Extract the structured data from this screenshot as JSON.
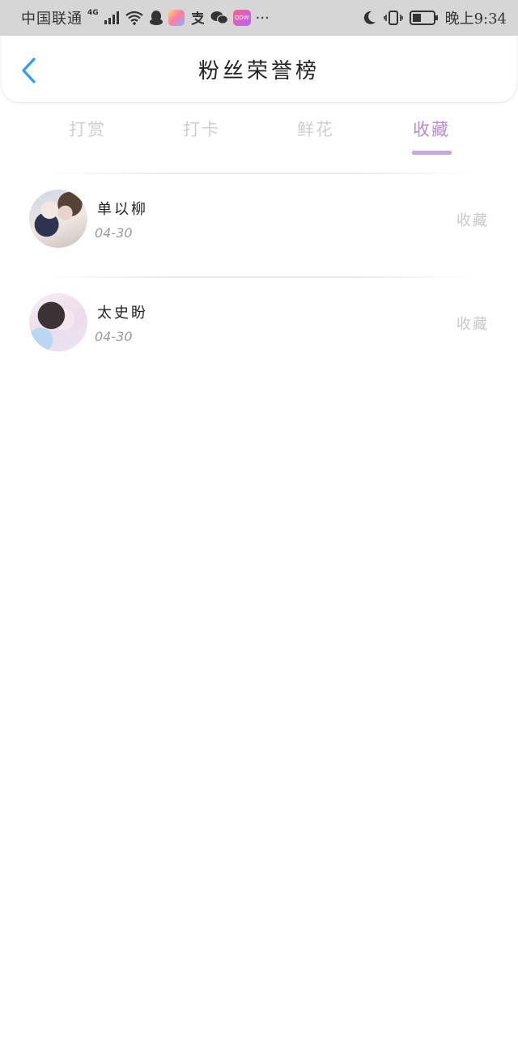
{
  "status_bar": {
    "carrier": "中国联通",
    "network": "4G",
    "more": "···",
    "time": "晚上9:34",
    "icons": [
      "signal-icon",
      "wifi-icon",
      "qq-icon",
      "photos-app-icon",
      "alipay-icon",
      "wechat-icon",
      "qdw-app-icon",
      "moon-icon",
      "vibrate-icon",
      "battery-icon"
    ]
  },
  "header": {
    "title": "粉丝荣誉榜",
    "back_icon": "chevron-left-icon",
    "accent_color": "#2f9df0"
  },
  "tabs": [
    {
      "label": "打赏",
      "active": false
    },
    {
      "label": "打卡",
      "active": false
    },
    {
      "label": "鲜花",
      "active": false
    },
    {
      "label": "收藏",
      "active": true
    }
  ],
  "active_tab_color": "#b88bd0",
  "fans": [
    {
      "name": "单以柳",
      "date": "04-30",
      "action": "收藏"
    },
    {
      "name": "太史盼",
      "date": "04-30",
      "action": "收藏"
    }
  ]
}
